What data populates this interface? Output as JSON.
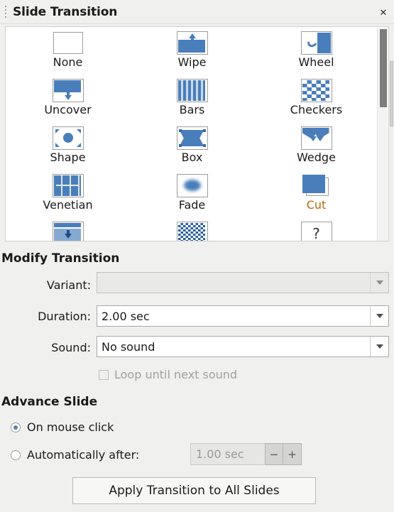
{
  "panel": {
    "title": "Slide Transition",
    "close_label": "✕",
    "grip_name": "panel-grip"
  },
  "transitions": {
    "rows": [
      [
        {
          "label": "None",
          "icon": "none-icon",
          "selected": false
        },
        {
          "label": "Wipe",
          "icon": "wipe-icon",
          "selected": false
        },
        {
          "label": "Wheel",
          "icon": "wheel-icon",
          "selected": false
        }
      ],
      [
        {
          "label": "Uncover",
          "icon": "uncover-icon",
          "selected": false
        },
        {
          "label": "Bars",
          "icon": "bars-icon",
          "selected": false
        },
        {
          "label": "Checkers",
          "icon": "checkers-icon",
          "selected": false
        }
      ],
      [
        {
          "label": "Shape",
          "icon": "shape-icon",
          "selected": false
        },
        {
          "label": "Box",
          "icon": "box-icon",
          "selected": false
        },
        {
          "label": "Wedge",
          "icon": "wedge-icon",
          "selected": false
        }
      ],
      [
        {
          "label": "Venetian",
          "icon": "venetian-icon",
          "selected": false
        },
        {
          "label": "Fade",
          "icon": "fade-icon",
          "selected": false
        },
        {
          "label": "Cut",
          "icon": "cut-icon",
          "selected": true
        }
      ]
    ],
    "partial_row": [
      {
        "label": "",
        "icon": "cover-icon"
      },
      {
        "label": "",
        "icon": "dissolve-icon"
      },
      {
        "label": "",
        "icon": "question-mark-icon"
      }
    ]
  },
  "modify": {
    "heading": "Modify Transition",
    "variant_label": "Variant:",
    "variant_value": "",
    "variant_enabled": false,
    "duration_label": "Duration:",
    "duration_value": "2.00 sec",
    "sound_label": "Sound:",
    "sound_value": "No sound",
    "loop_label": "Loop until next sound",
    "loop_checked": false,
    "loop_enabled": false
  },
  "advance": {
    "heading": "Advance Slide",
    "on_mouse_click_label": "On mouse click",
    "on_mouse_click_selected": true,
    "automatically_after_label": "Automatically after:",
    "automatically_after_selected": false,
    "auto_time_value": "1.00 sec",
    "auto_time_enabled": false,
    "decrement_label": "−",
    "increment_label": "+"
  },
  "apply": {
    "label": "Apply Transition to All Slides"
  },
  "colors": {
    "accent_blue": "#4a7ebb",
    "selected_label": "#b8690b",
    "panel_bg": "#f0f0ef",
    "grid_bg": "#ffffff"
  }
}
